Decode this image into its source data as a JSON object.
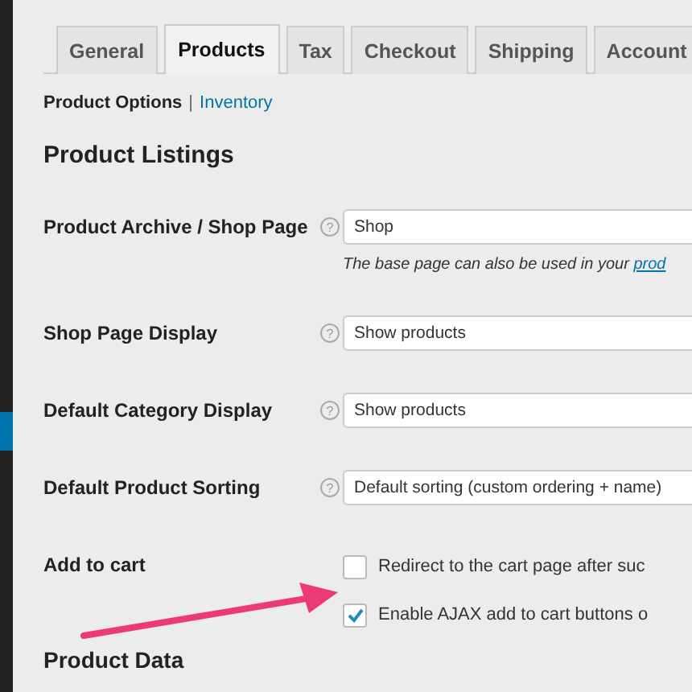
{
  "tabs": [
    {
      "label": "General",
      "selected": false
    },
    {
      "label": "Products",
      "selected": true
    },
    {
      "label": "Tax",
      "selected": false
    },
    {
      "label": "Checkout",
      "selected": false
    },
    {
      "label": "Shipping",
      "selected": false
    },
    {
      "label": "Account",
      "selected": false
    }
  ],
  "subnav": {
    "separator": "|",
    "items": [
      {
        "label": "Product Options",
        "selected": true
      },
      {
        "label": "Inventory",
        "selected": false
      }
    ]
  },
  "section_title": "Product Listings",
  "fields": [
    {
      "kind": "select",
      "label": "Product Archive / Shop Page",
      "help": "?",
      "value": "Shop",
      "description": "The base page can also be used in your ",
      "description_link": "prod"
    },
    {
      "kind": "select",
      "label": "Shop Page Display",
      "help": "?",
      "value": "Show products"
    },
    {
      "kind": "select",
      "label": "Default Category Display",
      "help": "?",
      "value": "Show products"
    },
    {
      "kind": "select",
      "label": "Default Product Sorting",
      "help": "?",
      "value": "Default sorting (custom ordering + name)"
    },
    {
      "kind": "checkboxes",
      "label": "Add to cart",
      "options": [
        {
          "label": "Redirect to the cart page after suc",
          "checked": false
        },
        {
          "label": "Enable AJAX add to cart buttons o",
          "checked": true
        }
      ]
    }
  ],
  "next_section_title": "Product Data"
}
